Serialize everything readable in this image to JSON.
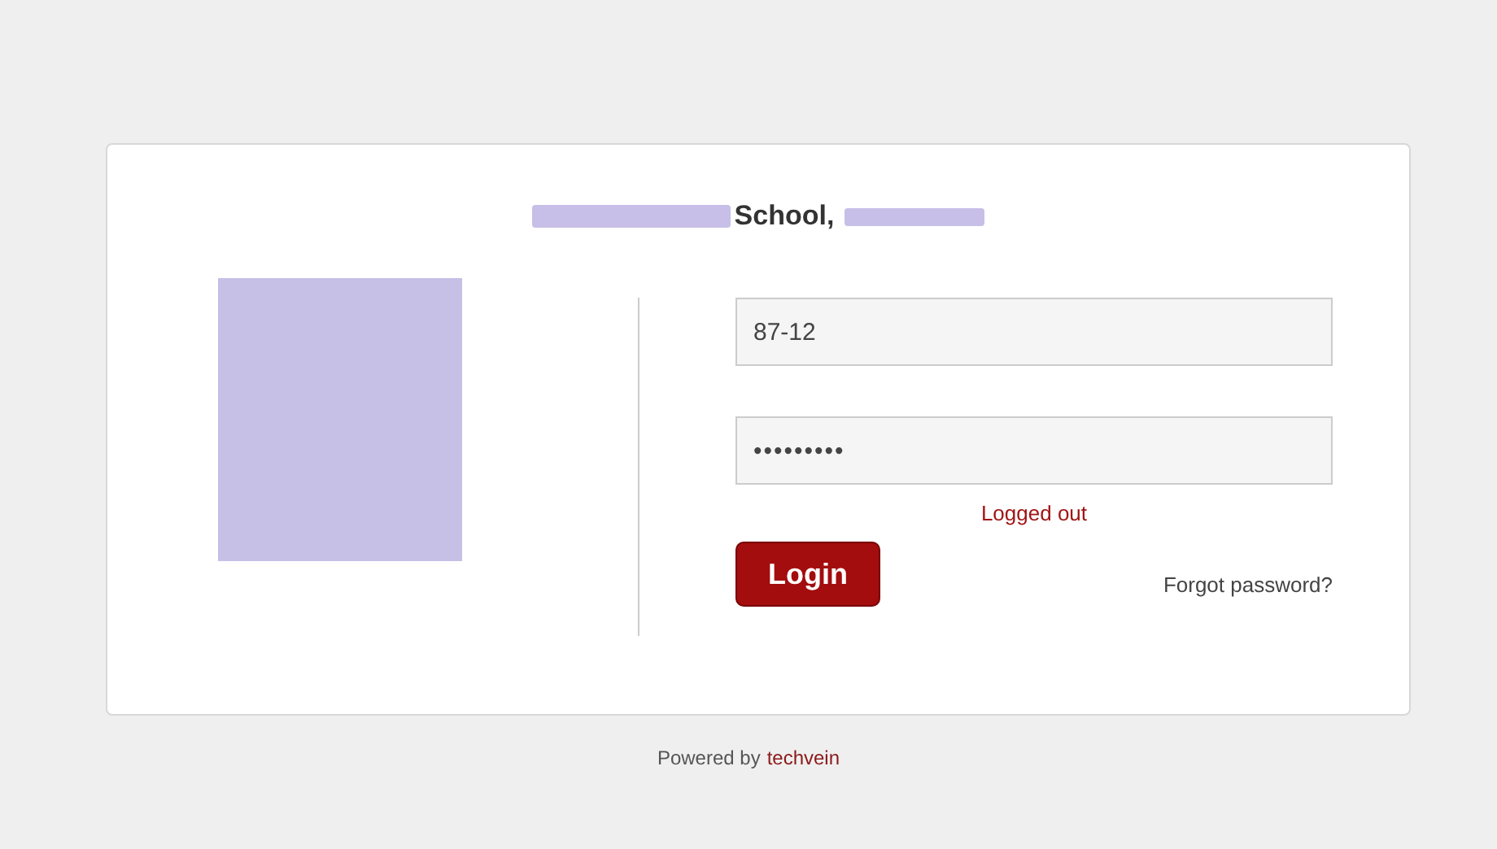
{
  "login_card": {
    "title": "School,",
    "username": {
      "value": "87-12"
    },
    "password": {
      "value": "•••••••••"
    },
    "status": "Logged out",
    "login_button": "Login",
    "forgot_link": "Forgot password?"
  },
  "footer": {
    "text": "Powered by",
    "link": "techvein"
  }
}
